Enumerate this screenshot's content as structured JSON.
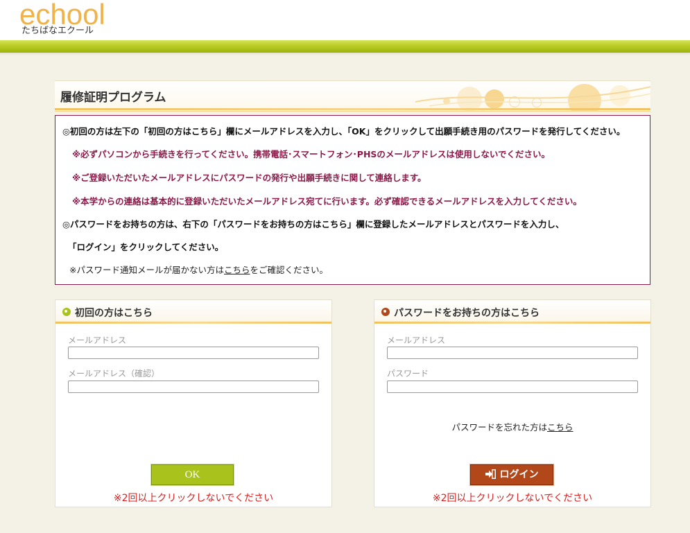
{
  "brand": {
    "logo": "echool",
    "subtitle": "たちばなエクール",
    "colors": {
      "accent_green": "#a9c21c",
      "accent_orange": "#f0b24a",
      "notice_red": "#8b1a4a",
      "login_brown": "#b2471a",
      "warn_red": "#d82020"
    }
  },
  "page": {
    "title": "履修証明プログラム"
  },
  "notice": {
    "line1": "◎初回の方は左下の「初回の方はこちら」欄にメールアドレスを入力し、「OK」をクリックして出願手続き用のパスワードを発行してください。",
    "line2": "※必ずパソコンから手続きを行ってください。携帯電話･スマートフォン･PHSのメールアドレスは使用しないでください。",
    "line3": "※ご登録いただいたメールアドレスにパスワードの発行や出願手続きに関して連絡します。",
    "line4": "※本学からの連絡は基本的に登録いただいたメールアドレス宛てに行います。必ず確認できるメールアドレスを入力してください。",
    "line5": "◎パスワードをお持ちの方は、右下の「パスワードをお持ちの方はこちら」欄に登録したメールアドレスとパスワードを入力し、",
    "line6": "「ログイン」をクリックしてください。",
    "line7_prefix": "※パスワード通知メールが届かない方は",
    "line7_link": "こちら",
    "line7_suffix": "をご確認ください。"
  },
  "first_time": {
    "heading": "初回の方はこちら",
    "email_label": "メールアドレス",
    "email_value": "",
    "email_confirm_label": "メールアドレス（確認）",
    "email_confirm_value": "",
    "ok_label": "OK",
    "warning": "※2回以上クリックしないでください"
  },
  "returning": {
    "heading": "パスワードをお持ちの方はこちら",
    "email_label": "メールアドレス",
    "email_value": "",
    "password_label": "パスワード",
    "password_value": "",
    "forgot_prefix": "パスワードを忘れた方は",
    "forgot_link": "こちら",
    "login_label": "ログイン",
    "warning": "※2回以上クリックしないでください"
  }
}
